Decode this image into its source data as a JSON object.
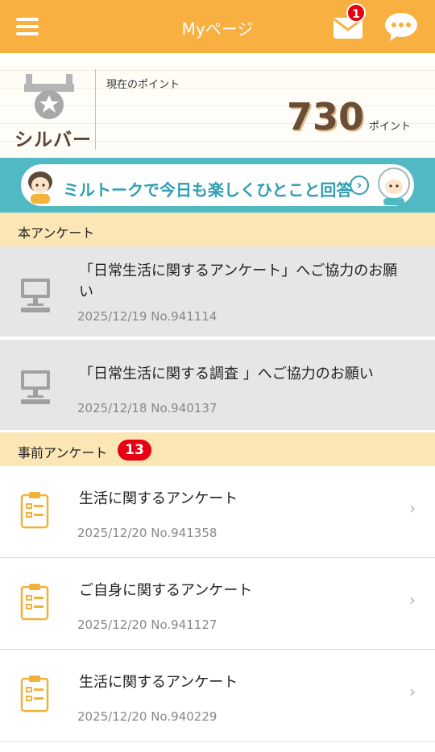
{
  "header": {
    "title": "Myページ",
    "mail_badge": "1"
  },
  "points": {
    "rank": "シルバー",
    "caption": "現在のポイント",
    "value": "730",
    "unit": "ポイント"
  },
  "banner": {
    "text": "ミルトークで今日も楽しくひとこと回答",
    "arrow": "›"
  },
  "sections": {
    "main_label": "本アンケート",
    "pre_label": "事前アンケート",
    "pre_count": "13"
  },
  "pc_surveys": [
    {
      "title": "「日常生活に関するアンケート」へご協力のお願い",
      "date": "2025/12/19",
      "no": "No.941114"
    },
    {
      "title": "「日常生活に関する調査 」へご協力のお願い",
      "date": "2025/12/18",
      "no": "No.940137"
    }
  ],
  "pre_surveys": [
    {
      "title": "生活に関するアンケート",
      "date": "2025/12/20",
      "no": "No.941358"
    },
    {
      "title": "ご自身に関するアンケート",
      "date": "2025/12/20",
      "no": "No.941127"
    },
    {
      "title": "生活に関するアンケート",
      "date": "2025/12/20",
      "no": "No.940229"
    }
  ],
  "icons": {
    "menu": "hamburger-menu-icon",
    "mail": "mail-icon",
    "chat": "chat-bubble-icon",
    "pc": "pc-monitor-icon",
    "clipboard": "clipboard-icon",
    "chevron": "chevron-right-icon"
  },
  "colors": {
    "header": "#f8b041",
    "section": "#fde6b5",
    "banner": "#50b9c4",
    "badge": "#e60012"
  }
}
